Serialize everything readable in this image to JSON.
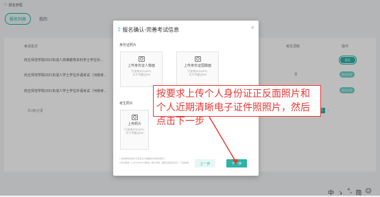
{
  "breadcrumb": {
    "home_icon": "home-icon",
    "text": "报名管理"
  },
  "tabs": [
    {
      "label": "报名列表",
      "active": true
    },
    {
      "label": "我的"
    }
  ],
  "table": {
    "headers": [
      "考试名次",
      "考生须知",
      "操作"
    ],
    "rows": [
      {
        "name": "商丘师范学院2022年成人高等教育本科学士学位外...",
        "action": "报名"
      },
      {
        "name": "商丘师范学院2021年成人学士学位外语考试（河南考...",
        "action": "报名信息"
      },
      {
        "name": "商丘师范学院2021年成人学士学位外语考试（河南考...",
        "action": "报名信息"
      }
    ],
    "total": "共3条记录",
    "page": "1"
  },
  "modal": {
    "title": "报名确认-完善考试信息",
    "id_section_label": "身份证照片",
    "upload_front": {
      "title": "上传身份证人像面",
      "hint1": "只支持JPG/JPG,",
      "hint2": "大小不超过2M"
    },
    "upload_back": {
      "title": "上传身份证国徽面",
      "hint1": "只支持JPG/JPG,",
      "hint2": "大小不超过2M"
    },
    "photo_section_label": "考生照片",
    "upload_photo": {
      "title": "上传照片",
      "hint1": "只支持JPG/JPG,",
      "hint2": "大小不超过2M"
    },
    "note1": "1.请选择考生照片与身份证人像面照片相符的照片；",
    "note2": "2.照片要求：a.尺寸480x640像素 b.照片清晰，面部全貌完整显示，不得模糊。",
    "prev_label": "上一步",
    "next_label": "下一步"
  },
  "annotation": {
    "text": "按要求上传个人身份证正反面照片和个人近期清晰电子证件照照片，然后点击下一步"
  },
  "tray": {
    "ime": "中",
    "punct": "ゝ",
    "dot": "°,",
    "settings": "简",
    "smile": "☺"
  },
  "colors": {
    "accent": "#2bb3a6",
    "annotation": "#e53935"
  }
}
